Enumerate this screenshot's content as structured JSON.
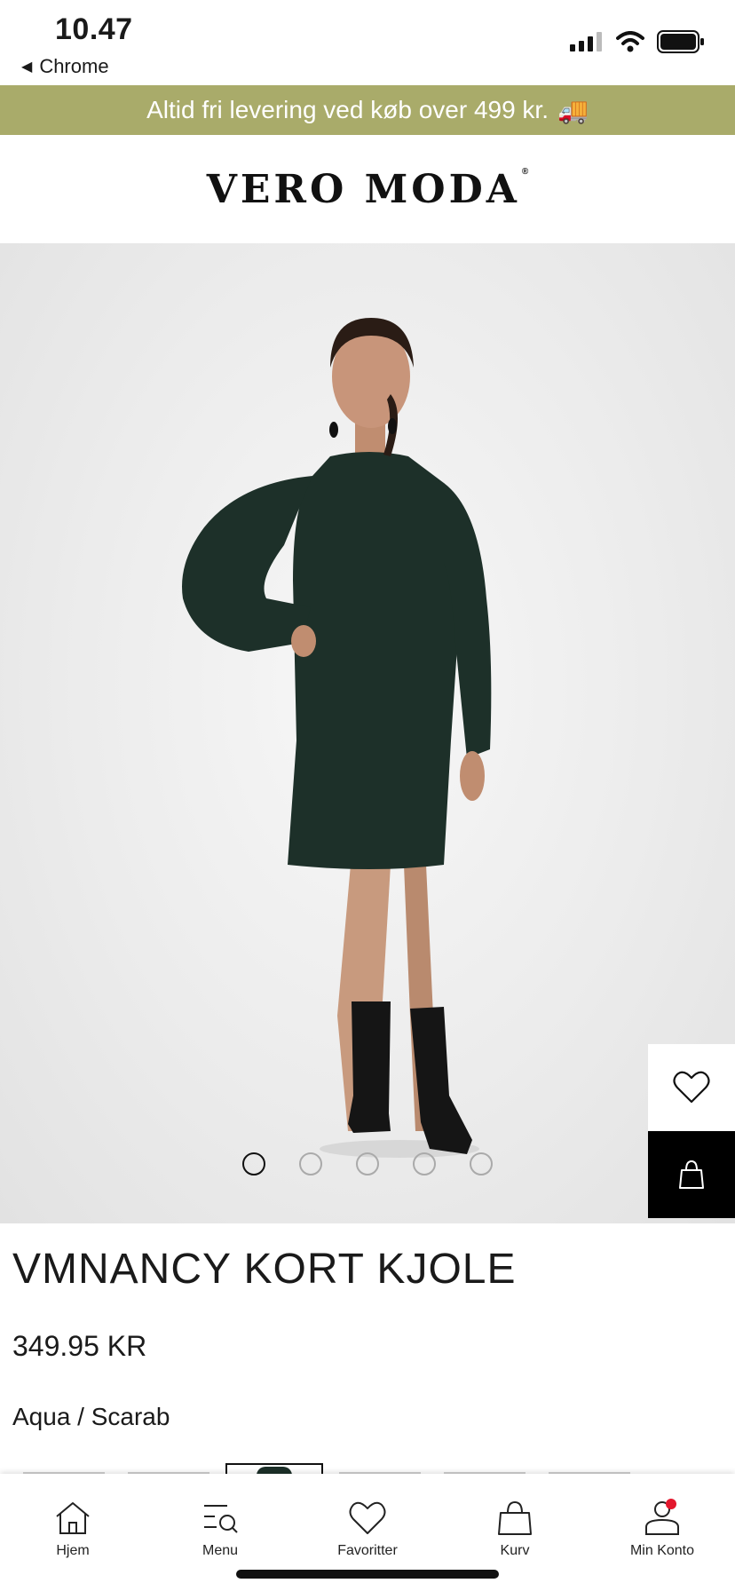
{
  "status_bar": {
    "time": "10.47",
    "back_label": "Chrome"
  },
  "promo": {
    "text": "Altid fri levering ved køb over 499 kr.",
    "emoji": "🚚"
  },
  "brand": {
    "logo_text": "VERO MODA",
    "registered_mark": "®"
  },
  "gallery": {
    "image_count": 5,
    "active_index": 0
  },
  "product": {
    "title": "VMNANCY KORT KJOLE",
    "price": "349.95 KR",
    "color": "Aqua / Scarab"
  },
  "bottom_nav": {
    "items": [
      {
        "label": "Hjem",
        "icon": "home-icon"
      },
      {
        "label": "Menu",
        "icon": "menu-search-icon"
      },
      {
        "label": "Favoritter",
        "icon": "heart-icon"
      },
      {
        "label": "Kurv",
        "icon": "bag-icon"
      },
      {
        "label": "Min Konto",
        "icon": "account-icon"
      }
    ]
  },
  "colors": {
    "promo_bg": "#a9ab6a",
    "dress": "#1d3029",
    "notification": "#e3172d"
  }
}
